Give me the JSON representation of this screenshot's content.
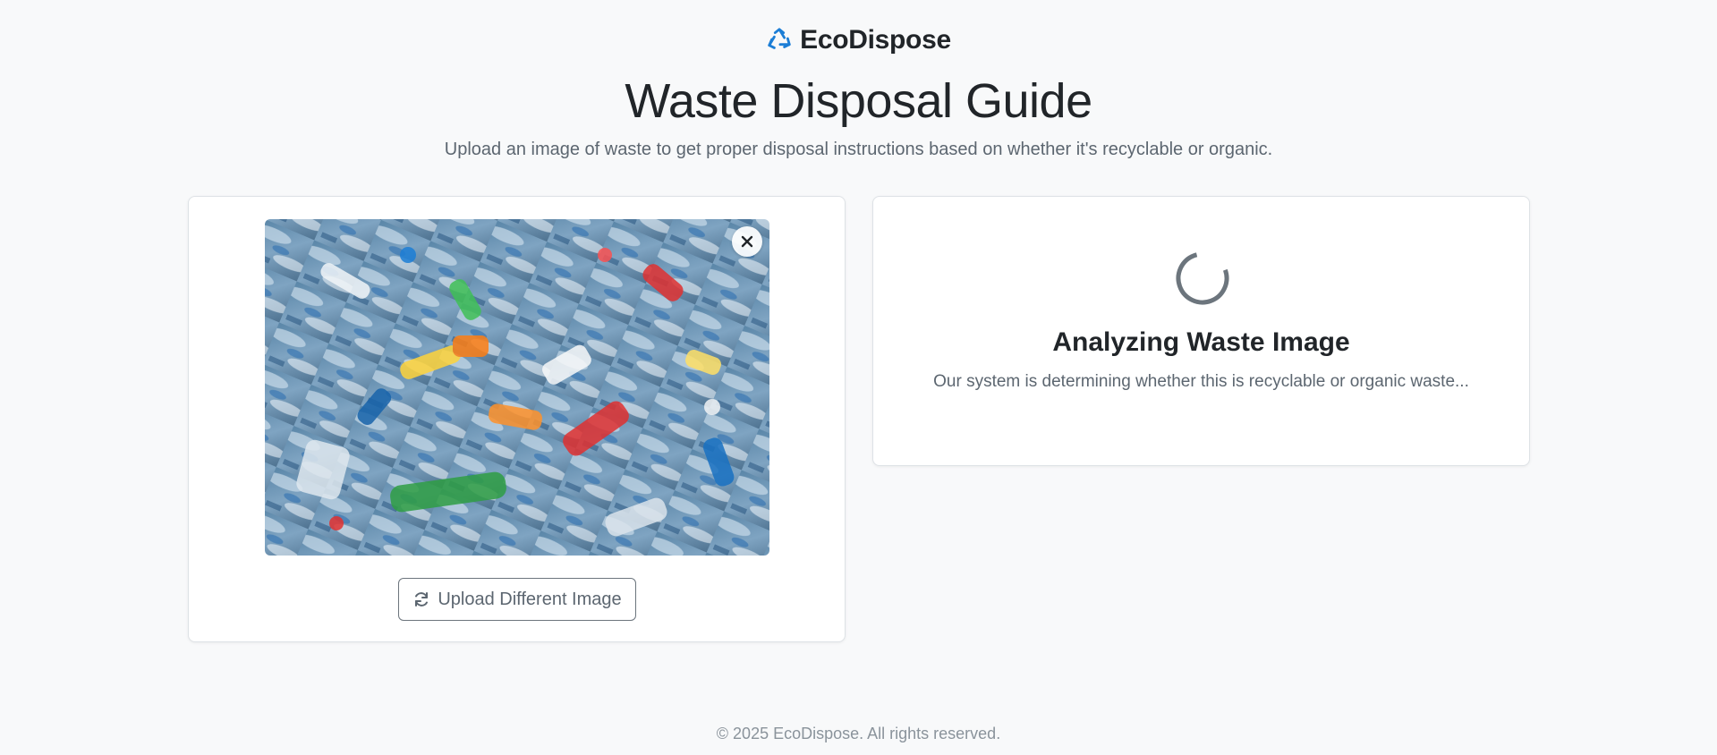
{
  "brand": {
    "name": "EcoDispose",
    "icon": "recycle-icon",
    "accent": "#1c7ed6"
  },
  "header": {
    "title": "Waste Disposal Guide",
    "subtitle": "Upload an image of waste to get proper disposal instructions based on whether it's recyclable or organic."
  },
  "upload": {
    "image_alt": "Pile of plastic bottles",
    "remove_icon": "close-icon",
    "button_label": "Upload Different Image",
    "button_icon": "refresh-icon"
  },
  "result": {
    "status_title": "Analyzing Waste Image",
    "status_text": "Our system is determining whether this is recyclable or organic waste..."
  },
  "footer": {
    "copyright": "© 2025 EcoDispose. All rights reserved."
  }
}
